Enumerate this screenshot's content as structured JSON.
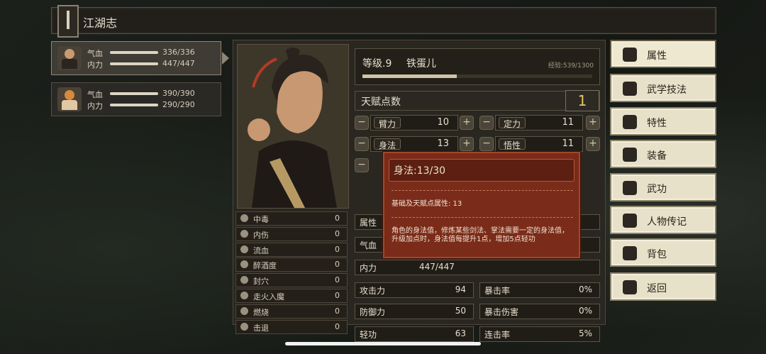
{
  "title": "江湖志",
  "party": [
    {
      "hp": "336/336",
      "mp": "447/447",
      "hp_label": "气血",
      "mp_label": "内力"
    },
    {
      "hp": "390/390",
      "mp": "290/290",
      "hp_label": "气血",
      "mp_label": "内力"
    }
  ],
  "character": {
    "level_label": "等级.9",
    "name": "铁蛋儿",
    "exp_text": "经验:539/1300",
    "exp_fraction": 0.41,
    "talent_label": "天赋点数",
    "talent_points": "1"
  },
  "attributes": [
    {
      "name": "臂力",
      "value": "10"
    },
    {
      "name": "定力",
      "value": "11"
    },
    {
      "name": "身法",
      "value": "13"
    },
    {
      "name": "悟性",
      "value": "11"
    }
  ],
  "status_effects": [
    {
      "name": "中毒",
      "value": "0"
    },
    {
      "name": "内伤",
      "value": "0"
    },
    {
      "name": "流血",
      "value": "0"
    },
    {
      "name": "醉酒度",
      "value": "0"
    },
    {
      "name": "封穴",
      "value": "0"
    },
    {
      "name": "走火入魔",
      "value": "0"
    },
    {
      "name": "燃烧",
      "value": "0"
    },
    {
      "name": "击退",
      "value": "0"
    }
  ],
  "partial_labels": {
    "attr_section": "属性",
    "hp": "气血",
    "mp": "内力",
    "mp_value": "447/447"
  },
  "combat_stats": [
    {
      "label": "攻击力",
      "value": "94",
      "label2": "暴击率",
      "value2": "0%"
    },
    {
      "label": "防御力",
      "value": "50",
      "label2": "暴击伤害",
      "value2": "0%"
    },
    {
      "label": "轻功",
      "value": "63",
      "label2": "连击率",
      "value2": "5%"
    }
  ],
  "tooltip": {
    "title": "身法:13/30",
    "base_line": "基础及天赋点属性: 13",
    "description": "角色的身法值，修炼某些剑法、掌法需要一定的身法值，升级加点时，身法值每提升1点，增加5点轻功"
  },
  "menu": [
    {
      "label": "属性",
      "icon": "person-icon"
    },
    {
      "label": "武学技法",
      "icon": "martial-skill-icon"
    },
    {
      "label": "特性",
      "icon": "trait-icon"
    },
    {
      "label": "装备",
      "icon": "sword-icon"
    },
    {
      "label": "武功",
      "icon": "book-icon"
    },
    {
      "label": "人物传记",
      "icon": "biography-icon"
    },
    {
      "label": "背包",
      "icon": "bag-icon"
    },
    {
      "label": "返回",
      "icon": "door-icon"
    }
  ],
  "colors": {
    "tooltip_bg": "#7a2b19",
    "accent_gold": "#e9c469",
    "menu_bg": "#e8e1c9"
  }
}
